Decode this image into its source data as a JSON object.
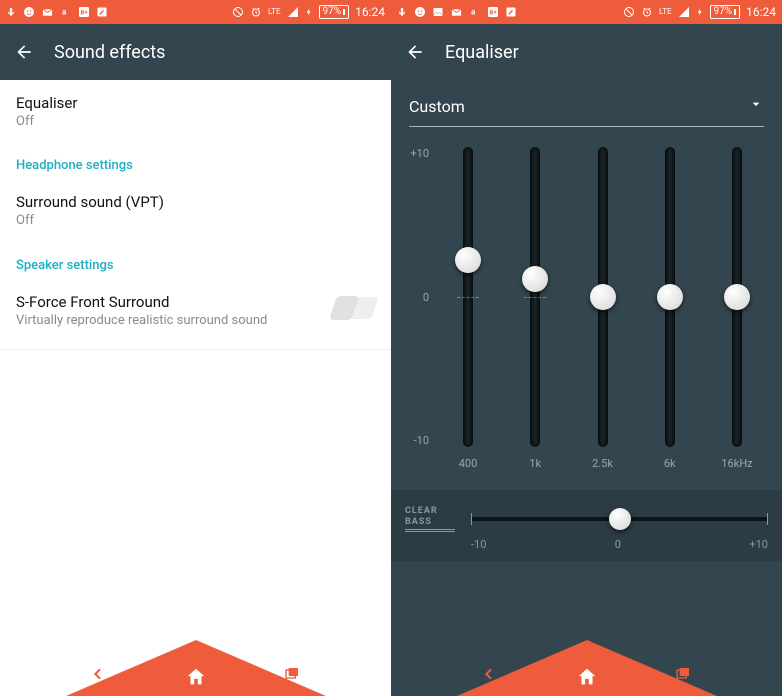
{
  "status": {
    "time": "16:24",
    "battery": "97%",
    "network": "LTE"
  },
  "left": {
    "title": "Sound effects",
    "rows": {
      "equaliser": {
        "label": "Equaliser",
        "value": "Off"
      },
      "section_hp": "Headphone settings",
      "surround": {
        "label": "Surround sound (VPT)",
        "value": "Off"
      },
      "section_sp": "Speaker settings",
      "sforce": {
        "label": "S-Force Front Surround",
        "desc": "Virtually reproduce realistic surround sound",
        "toggled": false
      }
    }
  },
  "right": {
    "title": "Equaliser",
    "preset": "Custom",
    "scale": {
      "max": "+10",
      "mid": "0",
      "min": "-10"
    },
    "bands": [
      {
        "freq": "400",
        "value": 2.5
      },
      {
        "freq": "1k",
        "value": 1.2
      },
      {
        "freq": "2.5k",
        "value": 0
      },
      {
        "freq": "6k",
        "value": 0
      },
      {
        "freq": "16kHz",
        "value": 0
      }
    ],
    "clear_bass": {
      "logo_top": "CLEAR",
      "logo_bot": "BASS",
      "value": 0,
      "scale_min": "-10",
      "scale_mid": "0",
      "scale_max": "+10"
    }
  }
}
